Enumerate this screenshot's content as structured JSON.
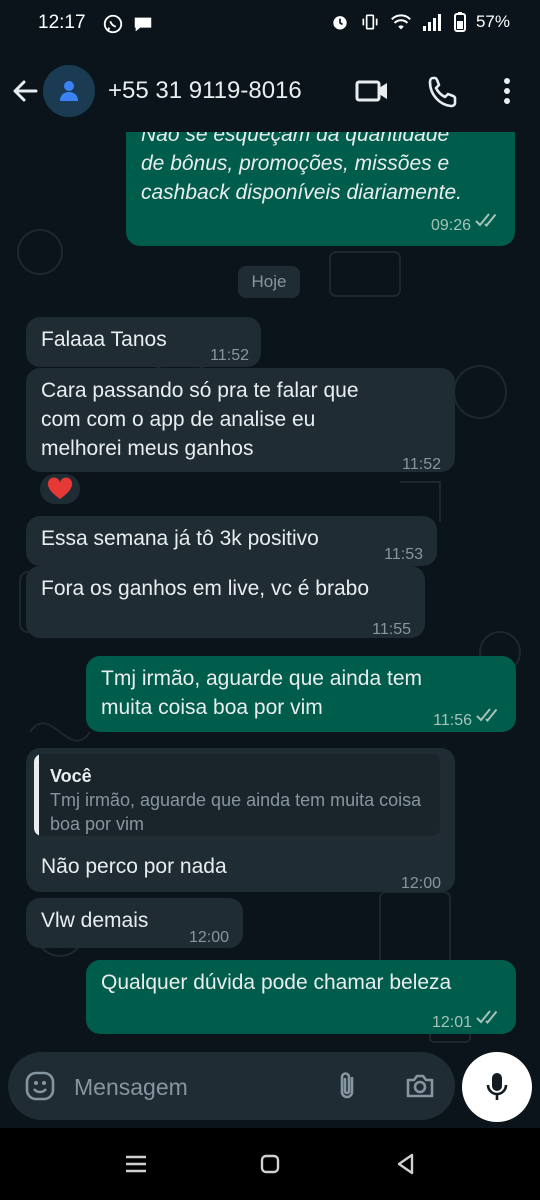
{
  "status_bar": {
    "time": "12:17",
    "battery": "57%"
  },
  "header": {
    "contact": "+55 31 9119-8016"
  },
  "date_divider": "Hoje",
  "messages": [
    {
      "dir": "out",
      "text": "Não se esqueçam da quantidade\nde bônus, promoções, missões e\ncashback disponíveis diariamente.",
      "time": "09:26"
    },
    {
      "dir": "in",
      "text": "Falaaa Tanos",
      "time": "11:52"
    },
    {
      "dir": "in",
      "text": "Cara passando só pra te falar que\ncom com o app de analise eu\nmelhorei meus ganhos",
      "time": "11:52",
      "reaction": "❤️"
    },
    {
      "dir": "in",
      "text": "Essa semana já tô 3k positivo",
      "time": "11:53"
    },
    {
      "dir": "in",
      "text": "Fora os ganhos em live, vc é brabo",
      "time": "11:55"
    },
    {
      "dir": "out",
      "text": "Tmj irmão,  aguarde que ainda tem\nmuita coisa boa por vim",
      "time": "11:56"
    },
    {
      "dir": "in",
      "text": "Não perco por nada",
      "time": "12:00",
      "quote": {
        "author": "Você",
        "text": "Tmj irmão,  aguarde que ainda tem muita coisa boa por vim"
      }
    },
    {
      "dir": "in",
      "text": "Vlw demais",
      "time": "12:00"
    },
    {
      "dir": "out",
      "text": "Qualquer dúvida pode chamar beleza",
      "time": "12:01"
    }
  ],
  "composer": {
    "placeholder": "Mensagem"
  },
  "colors": {
    "background": "#0b141a",
    "incoming": "#1f2c34",
    "outgoing": "#005c4b",
    "read_ticks": "#a6c3bb"
  }
}
